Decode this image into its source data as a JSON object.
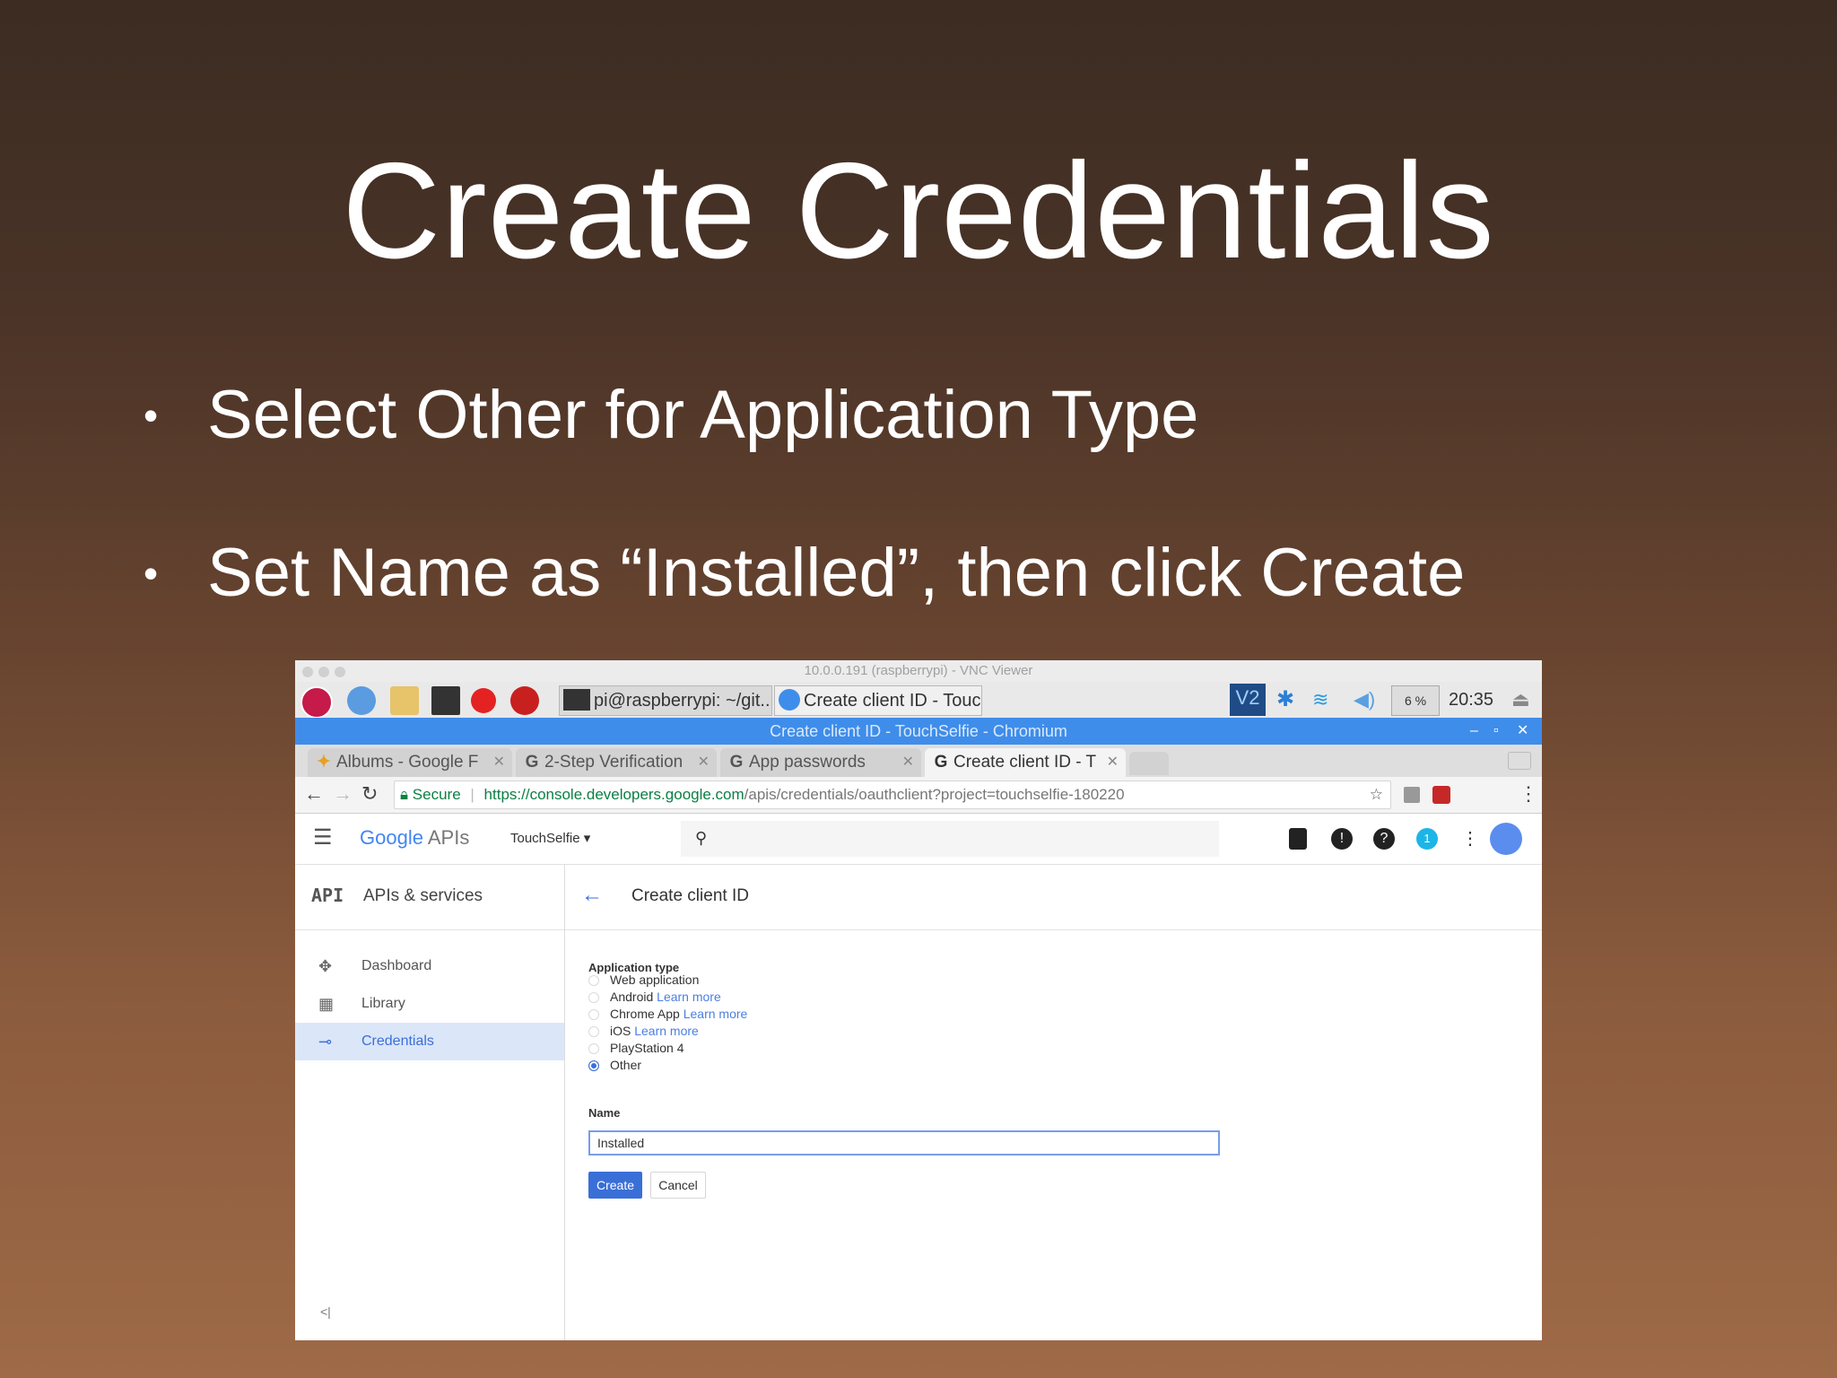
{
  "slide": {
    "title": "Create Credentials",
    "bullets": [
      "Select Other for Application Type",
      "Set Name as “Installed”, then click Create"
    ]
  },
  "vnc": {
    "title": "10.0.0.191 (raspberrypi) - VNC Viewer"
  },
  "taskbar": {
    "tasks": [
      "pi@raspberrypi: ~/git...",
      "Create client ID - Touc..."
    ],
    "cpu": "6 %",
    "clock": "20:35"
  },
  "chrome": {
    "window_title": "Create client ID - TouchSelfie - Chromium",
    "tabs": [
      {
        "label": "Albums - Google F",
        "favicon": "photos-icon"
      },
      {
        "label": "2-Step Verification",
        "favicon": "G"
      },
      {
        "label": "App passwords",
        "favicon": "G"
      },
      {
        "label": "Create client ID - T",
        "favicon": "G"
      }
    ],
    "secure_label": "Secure",
    "url_host": "https://console.developers.google.com",
    "url_path": "/apis/credentials/oauthclient?project=touchselfie-180220"
  },
  "gapi": {
    "logo_google": "Google",
    "logo_apis": "APIs",
    "project": "TouchSelfie",
    "notification_count": "1"
  },
  "sidebar": {
    "badge": "API",
    "title": "APIs & services",
    "items": [
      {
        "label": "Dashboard",
        "icon": "dashboard-icon"
      },
      {
        "label": "Library",
        "icon": "library-icon"
      },
      {
        "label": "Credentials",
        "icon": "key-icon"
      }
    ],
    "collapse": "<|"
  },
  "main": {
    "page_title": "Create client ID",
    "app_type_label": "Application type",
    "options": [
      {
        "label": "Web application",
        "learn_more": ""
      },
      {
        "label": "Android",
        "learn_more": "Learn more"
      },
      {
        "label": "Chrome App",
        "learn_more": "Learn more"
      },
      {
        "label": "iOS",
        "learn_more": "Learn more"
      },
      {
        "label": "PlayStation 4",
        "learn_more": ""
      },
      {
        "label": "Other",
        "learn_more": ""
      }
    ],
    "selected_option": "Other",
    "name_label": "Name",
    "name_value": "Installed",
    "create_label": "Create",
    "cancel_label": "Cancel"
  },
  "colors": {
    "accent": "#3a6fd8",
    "chrome_titlebar": "#3f8dea",
    "sidebar_active": "#dbe6f9"
  }
}
